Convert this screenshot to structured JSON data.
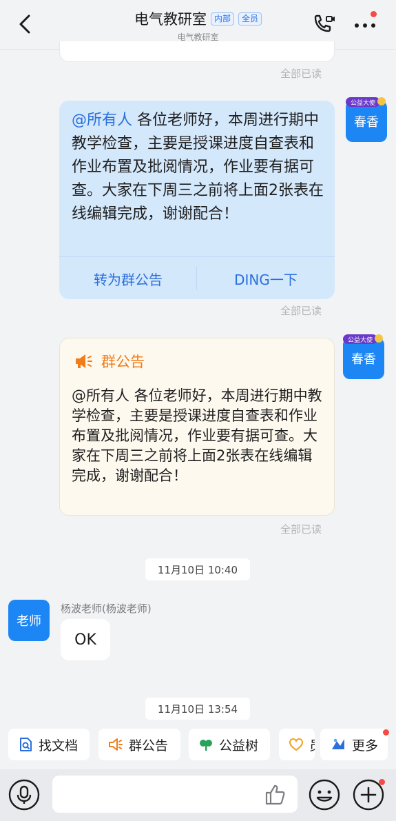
{
  "header": {
    "title": "电气教研室",
    "tag_internal": "内部",
    "tag_all": "全员",
    "subtitle": "电气教研室"
  },
  "read_status": "全部已读",
  "messages": {
    "broadcast": {
      "avatar_text": "春香",
      "badge_text": "公益大使",
      "mention": "@所有人",
      "body": " 各位老师好，本周进行期中教学检查，主要是授课进度自查表和作业布置及批阅情况，作业要有据可查。大家在下周三之前将上面2张表在线编辑完成，谢谢配合！",
      "action_announce": "转为群公告",
      "action_ding": "DING一下"
    },
    "notice": {
      "avatar_text": "春香",
      "title": "群公告",
      "body": "@所有人 各位老师好，本周进行期中教学检查，主要是授课进度自查表和作业布置及批阅情况，作业要有据可查。大家在下周三之前将上面2张表在线编辑完成，谢谢配合！"
    },
    "time1": "11月10日 10:40",
    "reply": {
      "avatar_text": "老师",
      "sender": "杨波老师(杨波老师)",
      "text": "OK"
    },
    "time2": "11月10日 13:54"
  },
  "quick_bar": [
    {
      "icon": "search-doc-icon",
      "label": "找文档"
    },
    {
      "icon": "megaphone-icon",
      "label": "群公告"
    },
    {
      "icon": "tree-icon",
      "label": "公益树"
    },
    {
      "icon": "heart-icon",
      "label": "员"
    },
    {
      "icon": "more-apps-icon",
      "label": "更多"
    }
  ],
  "input": {
    "placeholder": ""
  },
  "colors": {
    "accent": "#1d86f5",
    "link": "#2a6fdc",
    "notice": "#f07d1a",
    "badge": "#f54a45"
  }
}
